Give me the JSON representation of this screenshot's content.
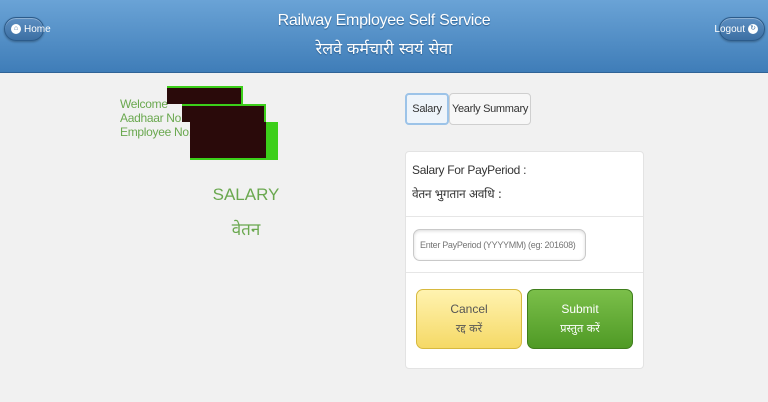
{
  "header": {
    "title_en": "Railway Employee Self Service",
    "title_hi": "रेलवे कर्मचारी स्वयं सेवा",
    "home_label": "Home",
    "logout_label": "Logout"
  },
  "user": {
    "welcome": "Welcome",
    "aadhaar": "Aadhaar No.",
    "employee": "Employee No."
  },
  "section": {
    "title_en": "SALARY",
    "title_hi": "वेतन"
  },
  "tabs": [
    {
      "label": "Salary",
      "active": true
    },
    {
      "label": "Yearly Summary",
      "active": false
    }
  ],
  "form": {
    "period_label_en": "Salary For PayPeriod :",
    "period_label_hi": "वेतन भुगतान अवधि :",
    "input_placeholder": "Enter PayPeriod (YYYYMM) (eg: 201608)",
    "input_value": ""
  },
  "buttons": {
    "cancel_en": "Cancel",
    "cancel_hi": "रद्द करें",
    "submit_en": "Submit",
    "submit_hi": "प्रस्तुत करें"
  }
}
